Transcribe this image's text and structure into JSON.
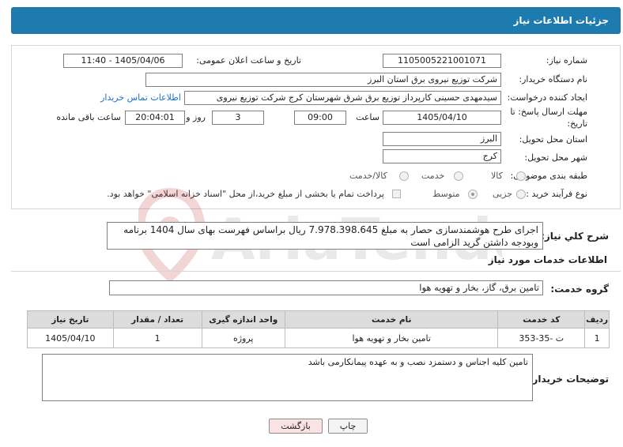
{
  "header": {
    "title": "جزئیات اطلاعات نیاز"
  },
  "form": {
    "need_number": {
      "label": "شماره نیاز:",
      "value": "1105005221001071"
    },
    "announce_datetime": {
      "label": "تاریخ و ساعت اعلان عمومی:",
      "value": "1405/04/06 - 11:40"
    },
    "buyer_org": {
      "label": "نام دستگاه خریدار:",
      "value": "شرکت توزیع نیروی برق استان البرز"
    },
    "requester": {
      "label": "ایجاد کننده درخواست:",
      "value": "سیدمهدی حسینی کارپرداز توزیع برق شرق شهرستان کرج شرکت توزیع نیروی",
      "contact_link": "اطلاعات تماس خریدار"
    },
    "deadline": {
      "label_line1": "مهلت ارسال پاسخ: تا",
      "label_line2": "تاریخ:",
      "date": "1405/04/10",
      "time_label": "ساعت",
      "time": "09:00",
      "days": "3",
      "days_label": "روز و",
      "remaining": "20:04:01",
      "remaining_label": "ساعت باقی مانده"
    },
    "province": {
      "label": "استان محل تحویل:",
      "value": "البرز"
    },
    "city": {
      "label": "شهر محل تحویل:",
      "value": "کرج"
    },
    "category": {
      "label": "طبقه بندی موضوعی:",
      "options": [
        "کالا",
        "خدمت",
        "کالا/خدمت"
      ]
    },
    "purchase_type": {
      "label": "نوع فرآیند خرید :",
      "options": [
        "جزیی",
        "متوسط"
      ],
      "payment_note": "پرداخت تمام یا بخشی از مبلغ خرید،از محل \"اسناد خزانه اسلامی\" خواهد بود."
    }
  },
  "summary": {
    "label": "شرح کلي نياز:",
    "text": "اجرای طرح هوشمندسازی حصار به مبلغ 7.978.398.645 ریال براساس فهرست بهای سال 1404 برنامه وبودجه داشتن گرید الزامی است"
  },
  "services": {
    "section_title": "اطلاعات خدمات مورد نیاز",
    "group_label": "گروه خدمت:",
    "group_value": "تامین برق، گاز، بخار و تهویه هوا",
    "table": {
      "headers": [
        "ردیف",
        "کد خدمت",
        "نام خدمت",
        "واحد اندازه گیری",
        "تعداد / مقدار",
        "تاریخ نیاز"
      ],
      "rows": [
        [
          "1",
          "ت -35-353",
          "تامین بخار و تهویه هوا",
          "پروژه",
          "1",
          "1405/04/10"
        ]
      ]
    }
  },
  "buyer_notes": {
    "label": "توضیحات خریدار:",
    "text": "تامین کلیه اجناس و دستمزد نصب و به عهده پیمانکارمی باشد"
  },
  "buttons": {
    "print": "چاپ",
    "back": "بازگشت"
  },
  "watermark": {
    "text": "AriaTender.net"
  },
  "colors": {
    "header_bg": "#1e7bb0",
    "link": "#1a73c9",
    "back_button_bg": "#fbe3e3"
  }
}
